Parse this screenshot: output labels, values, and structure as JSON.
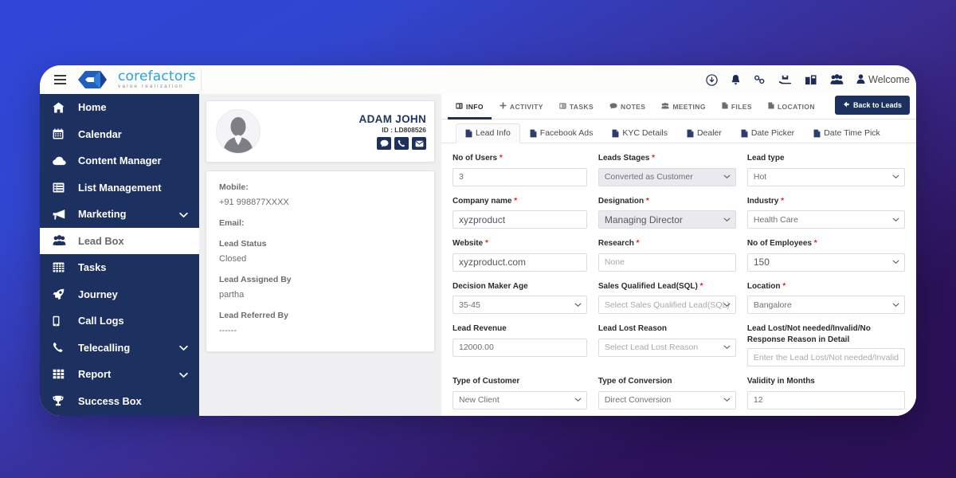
{
  "brand": {
    "name": "corefactors",
    "tagline": "value realization",
    "accent": "#29a3dc",
    "sidebar_bg": "#1d3160"
  },
  "topbar": {
    "menu_icon": "hamburger-icon",
    "icons": [
      {
        "name": "download-circle-icon"
      },
      {
        "name": "bell-icon"
      },
      {
        "name": "link-icon"
      },
      {
        "name": "hand-box-icon"
      },
      {
        "name": "product-box-icon"
      },
      {
        "name": "people-group-icon"
      }
    ],
    "welcome_label": "Welcome"
  },
  "sidebar": {
    "items": [
      {
        "label": "Home",
        "icon": "home-icon",
        "chevron": false,
        "active": false
      },
      {
        "label": "Calendar",
        "icon": "calendar-icon",
        "chevron": false,
        "active": false
      },
      {
        "label": "Content Manager",
        "icon": "cloud-icon",
        "chevron": false,
        "active": false
      },
      {
        "label": "List Management",
        "icon": "list-icon",
        "chevron": false,
        "active": false
      },
      {
        "label": "Marketing",
        "icon": "megaphone-icon",
        "chevron": true,
        "active": false
      },
      {
        "label": "Lead Box",
        "icon": "people-group-icon",
        "chevron": false,
        "active": true
      },
      {
        "label": "Tasks",
        "icon": "grid-table-icon",
        "chevron": false,
        "active": false
      },
      {
        "label": "Journey",
        "icon": "rocket-icon",
        "chevron": false,
        "active": false
      },
      {
        "label": "Call Logs",
        "icon": "mobile-icon",
        "chevron": false,
        "active": false
      },
      {
        "label": "Telecalling",
        "icon": "phone-icon",
        "chevron": true,
        "active": false
      },
      {
        "label": "Report",
        "icon": "grid-squares-icon",
        "chevron": true,
        "active": false
      },
      {
        "label": "Success Box",
        "icon": "trophy-icon",
        "chevron": false,
        "active": false
      }
    ]
  },
  "lead_card": {
    "avatar": "user-silhouette-avatar",
    "name": "ADAM JOHN",
    "id_label": "ID : LD808526",
    "actions": [
      {
        "name": "chat-icon"
      },
      {
        "name": "phone-icon"
      },
      {
        "name": "envelope-icon"
      }
    ],
    "fields": [
      {
        "label": "Mobile:",
        "value": "+91 998877XXXX"
      },
      {
        "label": "Email:",
        "value": ""
      },
      {
        "label": "Lead Status",
        "value": "Closed"
      },
      {
        "label": "Lead Assigned By",
        "value": "partha"
      },
      {
        "label": "Lead Referred By",
        "value": "------"
      }
    ]
  },
  "tabs": [
    {
      "label": "INFO",
      "icon": "info-card-icon",
      "active": true
    },
    {
      "label": "ACTIVITY",
      "icon": "plus-icon",
      "active": false
    },
    {
      "label": "TASKS",
      "icon": "tasks-icon",
      "active": false
    },
    {
      "label": "NOTES",
      "icon": "comment-icon",
      "active": false
    },
    {
      "label": "MEETING",
      "icon": "meeting-people-icon",
      "active": false
    },
    {
      "label": "FILES",
      "icon": "file-icon",
      "active": false
    },
    {
      "label": "LOCATION",
      "icon": "location-file-icon",
      "active": false
    }
  ],
  "back_button": {
    "label": "Back to Leads",
    "icon": "arrow-left-icon"
  },
  "subtabs": [
    {
      "label": "Lead Info",
      "icon": "file-icon",
      "active": true
    },
    {
      "label": "Facebook Ads",
      "icon": "file-icon",
      "active": false
    },
    {
      "label": "KYC Details",
      "icon": "file-icon",
      "active": false
    },
    {
      "label": "Dealer",
      "icon": "file-icon",
      "active": false
    },
    {
      "label": "Date Picker",
      "icon": "file-icon",
      "active": false
    },
    {
      "label": "Date Time Pick",
      "icon": "file-icon",
      "active": false
    }
  ],
  "form": {
    "fields": [
      {
        "label": "No of Users",
        "required": true,
        "type": "text",
        "value": "3",
        "placeholder": "",
        "shade": "light"
      },
      {
        "label": "Leads Stages",
        "required": true,
        "type": "select",
        "value": "Converted as Customer",
        "placeholder": "",
        "shade": "dark"
      },
      {
        "label": "Lead type",
        "required": false,
        "type": "select",
        "value": "Hot",
        "placeholder": "",
        "shade": "light"
      },
      {
        "label": "Company name",
        "required": true,
        "type": "text",
        "value": "xyzproduct",
        "placeholder": "",
        "shade": "light",
        "big": true
      },
      {
        "label": "Designation",
        "required": true,
        "type": "select",
        "value": "Managing Director",
        "placeholder": "",
        "shade": "dark",
        "big": true
      },
      {
        "label": "Industry",
        "required": true,
        "type": "select",
        "value": "Health Care",
        "placeholder": "",
        "shade": "light"
      },
      {
        "label": "Website",
        "required": true,
        "type": "text",
        "value": "xyzproduct.com",
        "placeholder": "",
        "shade": "light",
        "big": true
      },
      {
        "label": "Research",
        "required": true,
        "type": "text",
        "value": "",
        "placeholder": "None",
        "shade": "light"
      },
      {
        "label": "No of Employees",
        "required": true,
        "type": "select",
        "value": "150",
        "placeholder": "",
        "shade": "light",
        "big": true
      },
      {
        "label": "Decision Maker Age",
        "required": false,
        "type": "select",
        "value": "35-45",
        "placeholder": "",
        "shade": "light"
      },
      {
        "label": "Sales Qualified Lead(SQL)",
        "required": true,
        "type": "select",
        "value": "",
        "placeholder": "Select Sales Qualified Lead(SQL)",
        "shade": "light"
      },
      {
        "label": "Location",
        "required": true,
        "type": "select",
        "value": "Bangalore",
        "placeholder": "",
        "shade": "light"
      },
      {
        "label": "Lead Revenue",
        "required": false,
        "type": "text",
        "value": "12000.00",
        "placeholder": "",
        "shade": "light"
      },
      {
        "label": "Lead Lost Reason",
        "required": false,
        "type": "select",
        "value": "",
        "placeholder": "Select Lead Lost Reason",
        "shade": "light"
      },
      {
        "label": "Lead Lost/Not needed/Invalid/No Response Reason in Detail",
        "required": false,
        "type": "text",
        "value": "",
        "placeholder": "Enter the Lead Lost/Not needed/Invalid",
        "shade": "light",
        "twoline": true
      },
      {
        "label": "Type of Customer",
        "required": false,
        "type": "select",
        "value": "New Client",
        "placeholder": "",
        "shade": "light"
      },
      {
        "label": "Type of Conversion",
        "required": false,
        "type": "select",
        "value": "Direct Conversion",
        "placeholder": "",
        "shade": "light"
      },
      {
        "label": "Validity in Months",
        "required": false,
        "type": "text",
        "value": "12",
        "placeholder": "",
        "shade": "light"
      }
    ]
  }
}
